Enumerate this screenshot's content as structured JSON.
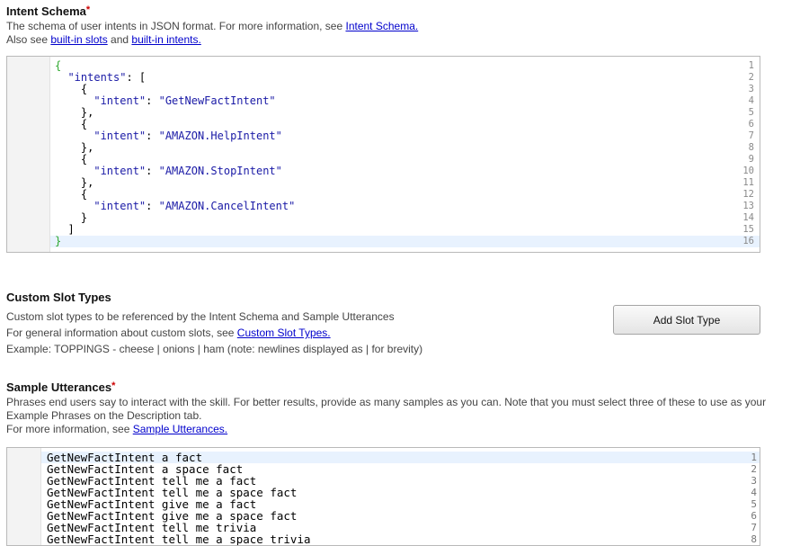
{
  "intent_schema": {
    "title": "Intent Schema",
    "required_mark": "*",
    "desc_line1_prefix": "The schema of user intents in JSON format. For more information, see ",
    "desc_line1_link": "Intent Schema.",
    "desc_line2_prefix": "Also see ",
    "desc_line2_link1": "built-in slots",
    "desc_line2_mid": " and ",
    "desc_line2_link2": "built-in intents.",
    "line_numbers": [
      "1",
      "2",
      "3",
      "4",
      "5",
      "6",
      "7",
      "8",
      "9",
      "10",
      "11",
      "12",
      "13",
      "14",
      "15",
      "16"
    ],
    "code_lines": [
      "{",
      "  \"intents\": [",
      "    {",
      "      \"intent\": \"GetNewFactIntent\"",
      "    },",
      "    {",
      "      \"intent\": \"AMAZON.HelpIntent\"",
      "    },",
      "    {",
      "      \"intent\": \"AMAZON.StopIntent\"",
      "    },",
      "    {",
      "      \"intent\": \"AMAZON.CancelIntent\"",
      "    }",
      "  ]",
      "}"
    ]
  },
  "custom_slot_types": {
    "title": "Custom Slot Types",
    "desc_line1": "Custom slot types to be referenced by the Intent Schema and Sample Utterances",
    "desc_line2_prefix": "For general information about custom slots, see ",
    "desc_line2_link": "Custom Slot Types.",
    "desc_line3": "Example: TOPPINGS - cheese | onions | ham (note: newlines displayed as | for brevity)",
    "add_button": "Add Slot Type"
  },
  "sample_utterances": {
    "title": "Sample Utterances",
    "required_mark": "*",
    "desc_line1": "Phrases end users say to interact with the skill. For better results, provide as many samples as you can. Note that you must select three of these to use as your",
    "desc_line2": "Example Phrases on the Description tab.",
    "desc_line3_prefix": "For more information, see ",
    "desc_line3_link": "Sample Utterances.",
    "line_numbers": [
      "1",
      "2",
      "3",
      "4",
      "5",
      "6",
      "7",
      "8"
    ],
    "lines": [
      "GetNewFactIntent a fact",
      "GetNewFactIntent a space fact",
      "GetNewFactIntent tell me a fact",
      "GetNewFactIntent tell me a space fact",
      "GetNewFactIntent give me a fact",
      "GetNewFactIntent give me a space fact",
      "GetNewFactIntent tell me trivia",
      "GetNewFactIntent tell me a space trivia"
    ]
  },
  "colors": {
    "required": "#cc0000",
    "link": "#0000cc",
    "bracket_green": "#2ea82e",
    "string_blue": "#1a1aa6",
    "active_line": "#e8f2fe"
  }
}
